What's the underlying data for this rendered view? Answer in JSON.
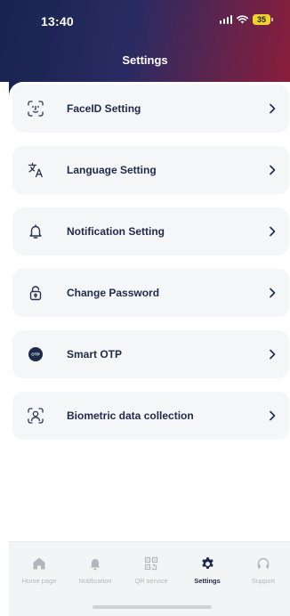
{
  "status_bar": {
    "time": "13:40",
    "battery": "35"
  },
  "header": {
    "title": "Settings"
  },
  "menu": {
    "items": [
      {
        "label": "FaceID Setting",
        "icon": "face-id-icon"
      },
      {
        "label": "Language Setting",
        "icon": "translate-icon"
      },
      {
        "label": "Notification Setting",
        "icon": "bell-icon"
      },
      {
        "label": "Change Password",
        "icon": "lock-icon"
      },
      {
        "label": "Smart OTP",
        "icon": "otp-icon",
        "icon_text": "OTP"
      },
      {
        "label": "Biometric data collection",
        "icon": "biometric-scan-icon"
      }
    ]
  },
  "tabbar": {
    "tabs": [
      {
        "label": "Home page",
        "icon": "home-icon",
        "active": false
      },
      {
        "label": "Notification",
        "icon": "bell-icon",
        "active": false
      },
      {
        "label": "QR service",
        "icon": "qr-code-icon",
        "active": false
      },
      {
        "label": "Settings",
        "icon": "gear-icon",
        "active": true
      },
      {
        "label": "Support",
        "icon": "headset-icon",
        "active": false
      }
    ]
  },
  "colors": {
    "header_gradient_start": "#17234f",
    "header_gradient_end": "#8c1d3a",
    "label_text": "#1f2a4a",
    "inactive_tab": "#b3b6bd",
    "battery": "#f1d22a"
  }
}
